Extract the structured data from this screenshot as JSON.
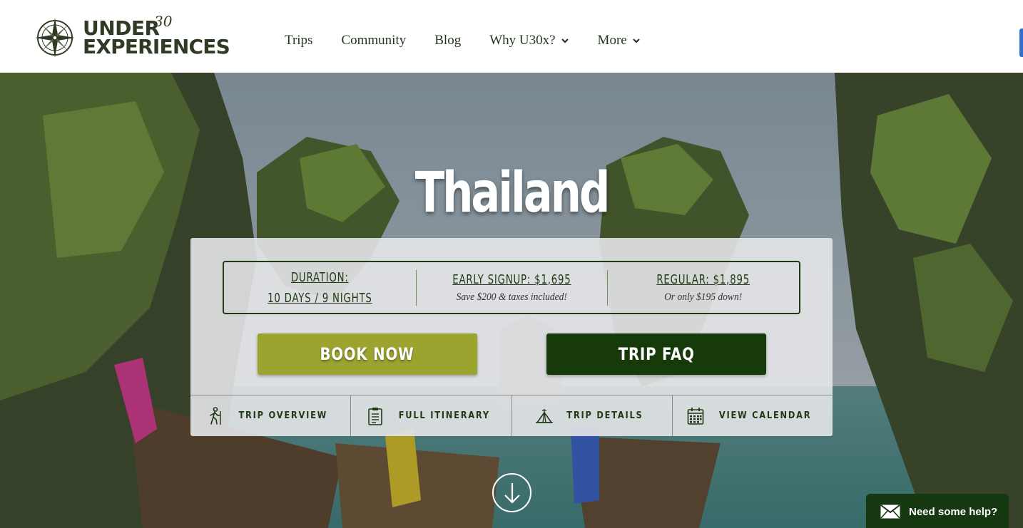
{
  "header": {
    "logo": {
      "line1": "UNDER",
      "superscript": "30",
      "line2": "EXPERIENCES"
    },
    "nav": [
      {
        "label": "Trips",
        "dropdown": false
      },
      {
        "label": "Community",
        "dropdown": false
      },
      {
        "label": "Blog",
        "dropdown": false
      },
      {
        "label": "Why U30x?",
        "dropdown": true
      },
      {
        "label": "More",
        "dropdown": true
      }
    ]
  },
  "hero": {
    "title": "Thailand",
    "prices": [
      {
        "heading": "DURATION:",
        "heading2": "10 DAYS / 9 NIGHTS",
        "sub": ""
      },
      {
        "heading": "EARLY SIGNUP: $1,695",
        "sub": "Save $200 & taxes included!"
      },
      {
        "heading": "REGULAR: $1,895",
        "sub": "Or only $195 down!"
      }
    ],
    "buttons": {
      "book": "BOOK NOW",
      "faq": "TRIP FAQ"
    },
    "tabs": [
      {
        "label": "TRIP OVERVIEW",
        "icon": "hiker-icon"
      },
      {
        "label": "FULL ITINERARY",
        "icon": "clipboard-icon"
      },
      {
        "label": "TRIP DETAILS",
        "icon": "tent-icon"
      },
      {
        "label": "VIEW CALENDAR",
        "icon": "calendar-icon"
      }
    ]
  },
  "help_widget": {
    "label": "Need some help?",
    "icon": "envelope-icon"
  },
  "colors": {
    "brand_dark": "#173a0b",
    "brand_olive": "#9ba42f",
    "nav_text": "#1f3a1a",
    "panel_bg": "#e4e6e8"
  }
}
